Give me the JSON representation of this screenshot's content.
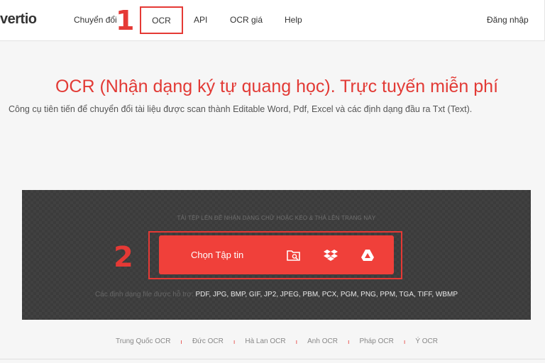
{
  "header": {
    "logo": "vertio",
    "nav": [
      "Chuyển đổi",
      "OCR",
      "API",
      "OCR giá",
      "Help"
    ],
    "login": "Đăng nhập"
  },
  "annotations": {
    "step1": "1",
    "step2": "2"
  },
  "hero": {
    "title": "OCR (Nhận dạng ký tự quang học). Trực tuyến miễn phí",
    "subtitle": "Công cụ tiên tiến để chuyển đổi tài liệu được scan thành Editable Word, Pdf, Excel và các định dạng đầu ra Txt (Text)."
  },
  "upload": {
    "hint": "TẢI TỆP LÊN ĐỂ NHẬN DẠNG CHỮ HOẶC KÉO & THẢ LÊN TRANG NÀY",
    "button_label": "Chọn Tập tin",
    "icons": [
      "folder-search-icon",
      "dropbox-icon",
      "google-drive-icon"
    ],
    "formats_prefix": "Các định dạng file được hỗ trợ:",
    "formats_list": "PDF, JPG, BMP, GIF, JP2, JPEG, PBM, PCX, PGM, PNG, PPM, TGA, TIFF, WBMP"
  },
  "footer_links": [
    "Trung Quốc OCR",
    "Đức OCR",
    "Hà Lan OCR",
    "Anh OCR",
    "Pháp OCR",
    "Ý OCR"
  ],
  "colors": {
    "accent": "#e53935",
    "button": "#f0403a",
    "panel": "#3b3b3b"
  }
}
